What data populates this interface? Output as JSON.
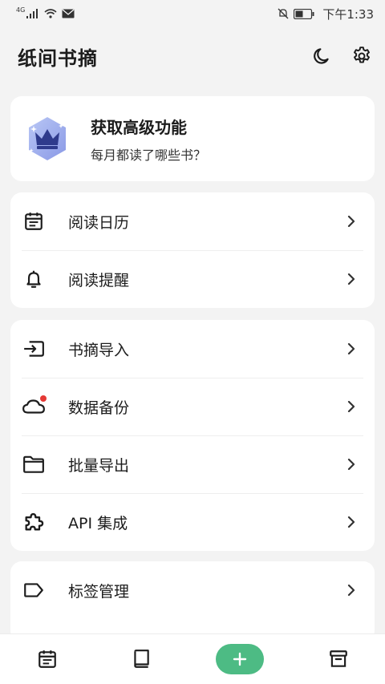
{
  "status_bar": {
    "network": "4G",
    "time": "下午1:33"
  },
  "header": {
    "title": "纸间书摘"
  },
  "promo": {
    "title": "获取高级功能",
    "subtitle": "每月都读了哪些书？"
  },
  "groups": [
    {
      "items": [
        {
          "label": "阅读日历",
          "icon": "calendar-icon"
        },
        {
          "label": "阅读提醒",
          "icon": "bell-icon"
        }
      ]
    },
    {
      "items": [
        {
          "label": "书摘导入",
          "icon": "import-icon"
        },
        {
          "label": "数据备份",
          "icon": "cloud-icon"
        },
        {
          "label": "批量导出",
          "icon": "folder-icon"
        },
        {
          "label": "API 集成",
          "icon": "puzzle-icon"
        }
      ]
    },
    {
      "items": [
        {
          "label": "标签管理",
          "icon": "tag-icon"
        }
      ]
    }
  ],
  "bottom_nav": [
    {
      "icon": "calendar-icon"
    },
    {
      "icon": "book-icon"
    },
    {
      "icon": "plus-icon"
    },
    {
      "icon": "archive-icon"
    }
  ],
  "colors": {
    "accent": "#4dbb84",
    "badge_red": "#e53935",
    "crown": "#2e3a8c"
  }
}
